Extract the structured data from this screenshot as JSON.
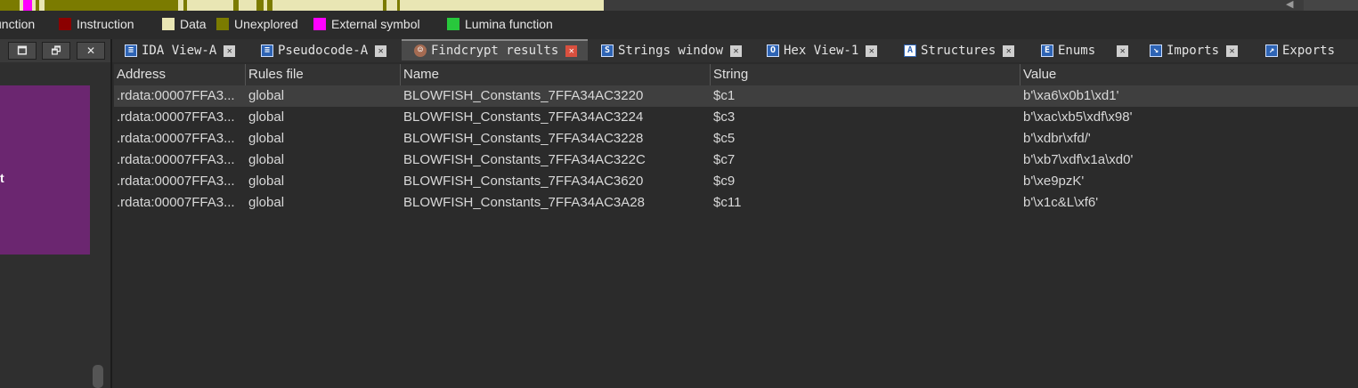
{
  "colors": {
    "unexplored": "#7b7b00",
    "data": "#e9e6b4",
    "instruction": "#8b0000",
    "external_symbol": "#ff00ff",
    "lumina_function": "#28c83c",
    "left_panel_accent": "#6b2670",
    "active_tab_close": "#d9503f"
  },
  "legend": [
    {
      "label": "unction",
      "color": "#6fa7d8"
    },
    {
      "label": "Instruction",
      "color": "#8b0000"
    },
    {
      "label": "Data",
      "color": "#e9e6b4"
    },
    {
      "label": "Unexplored",
      "color": "#7b7b00"
    },
    {
      "label": "External symbol",
      "color": "#ff00ff"
    },
    {
      "label": "Lumina function",
      "color": "#28c83c"
    }
  ],
  "left_panel": {
    "restore_button": "🗖",
    "float_button": "🗗",
    "close_button": "✕",
    "text_fragment": "t"
  },
  "tabs": [
    {
      "label": "IDA View-A",
      "icon": "ida-view-icon",
      "active": false
    },
    {
      "label": "Pseudocode-A",
      "icon": "pseudocode-icon",
      "active": false
    },
    {
      "label": "Findcrypt results",
      "icon": "findcrypt-icon",
      "active": true
    },
    {
      "label": "Strings window",
      "icon": "strings-icon",
      "active": false
    },
    {
      "label": "Hex View-1",
      "icon": "hex-view-icon",
      "active": false
    },
    {
      "label": "Structures",
      "icon": "structures-icon",
      "active": false
    },
    {
      "label": "Enums",
      "icon": "enums-icon",
      "active": false
    },
    {
      "label": "Imports",
      "icon": "imports-icon",
      "active": false
    },
    {
      "label": "Exports",
      "icon": "exports-icon",
      "active": false
    }
  ],
  "table": {
    "columns": [
      "Address",
      "Rules file",
      "Name",
      "String",
      "Value"
    ],
    "rows": [
      [
        ".rdata:00007FFA3...",
        "global",
        "BLOWFISH_Constants_7FFA34AC3220",
        "$c1",
        "b'\\xa6\\x0b1\\xd1'"
      ],
      [
        ".rdata:00007FFA3...",
        "global",
        "BLOWFISH_Constants_7FFA34AC3224",
        "$c3",
        "b'\\xac\\xb5\\xdf\\x98'"
      ],
      [
        ".rdata:00007FFA3...",
        "global",
        "BLOWFISH_Constants_7FFA34AC3228",
        "$c5",
        "b'\\xdbr\\xfd/'"
      ],
      [
        ".rdata:00007FFA3...",
        "global",
        "BLOWFISH_Constants_7FFA34AC322C",
        "$c7",
        "b'\\xb7\\xdf\\x1a\\xd0'"
      ],
      [
        ".rdata:00007FFA3...",
        "global",
        "BLOWFISH_Constants_7FFA34AC3620",
        "$c9",
        "b'\\xe9pzK'"
      ],
      [
        ".rdata:00007FFA3...",
        "global",
        "BLOWFISH_Constants_7FFA34AC3A28",
        "$c11",
        "b'\\x1c&L\\xf6'"
      ]
    ],
    "selected_row": 0
  }
}
